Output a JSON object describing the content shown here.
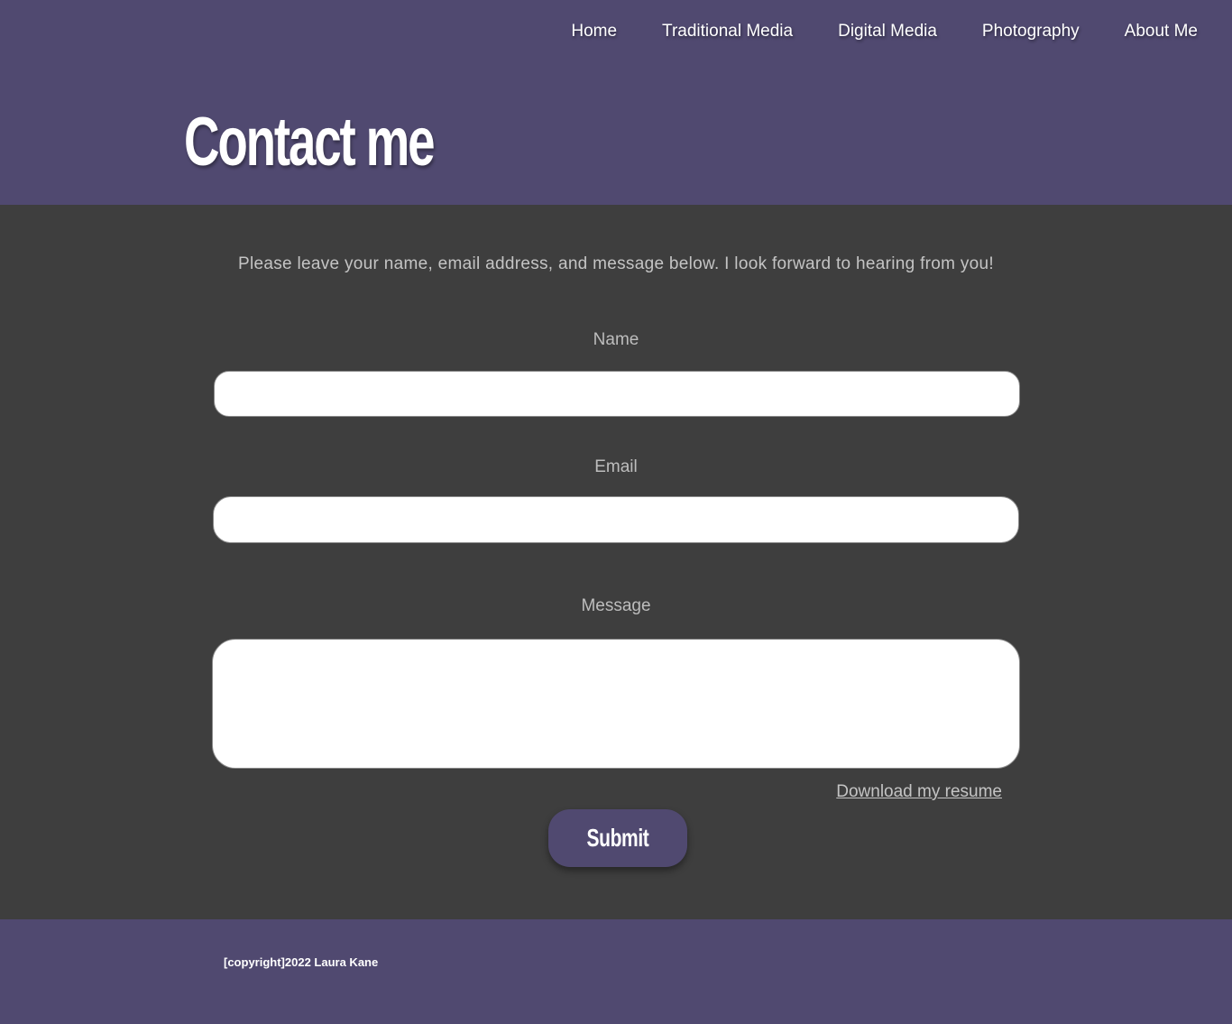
{
  "nav": {
    "items": [
      {
        "label": "Home"
      },
      {
        "label": "Traditional Media"
      },
      {
        "label": "Digital Media"
      },
      {
        "label": "Photography"
      },
      {
        "label": "About Me"
      }
    ]
  },
  "header": {
    "title": "Contact me"
  },
  "main": {
    "intro": "Please leave your name, email address, and message below. I look forward to hearing from you!",
    "form": {
      "name_label": "Name",
      "name_value": "",
      "email_label": "Email",
      "email_value": "",
      "message_label": "Message",
      "message_value": "",
      "resume_link": "Download my resume",
      "submit_label": "Submit"
    }
  },
  "footer": {
    "copyright": "[copyright]2022 Laura Kane"
  },
  "colors": {
    "header_bg": "#504970",
    "body_bg": "#3e3e3e",
    "text_muted": "#c4c4c4"
  }
}
